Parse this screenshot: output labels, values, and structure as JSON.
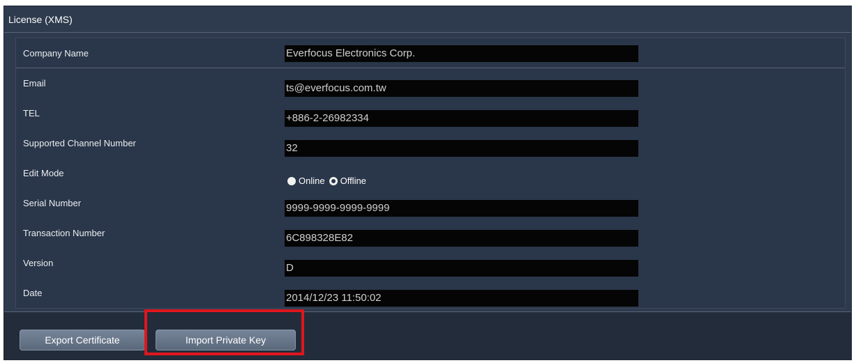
{
  "panel": {
    "title": "License (XMS)"
  },
  "fields": {
    "company_name": {
      "label": "Company Name",
      "value": "Everfocus Electronics Corp."
    },
    "email": {
      "label": "Email",
      "value": "ts@everfocus.com.tw"
    },
    "tel": {
      "label": "TEL",
      "value": "+886-2-26982334"
    },
    "supported_channels": {
      "label": "Supported Channel Number",
      "value": "32"
    },
    "edit_mode": {
      "label": "Edit Mode",
      "options": [
        "Online",
        "Offline"
      ],
      "selected": "Online"
    },
    "serial_number": {
      "label": "Serial Number",
      "value": "9999-9999-9999-9999"
    },
    "transaction_number": {
      "label": "Transaction Number",
      "value": "6C898328E82"
    },
    "version": {
      "label": "Version",
      "value": "D"
    },
    "date": {
      "label": "Date",
      "value": "2014/12/23 11:50:02"
    }
  },
  "footer": {
    "export_label": "Export Certificate",
    "import_label": "Import Private Key"
  },
  "colors": {
    "panel_bg": "#2e3b4e",
    "field_bg": "#050505",
    "highlight": "#e0161d"
  }
}
